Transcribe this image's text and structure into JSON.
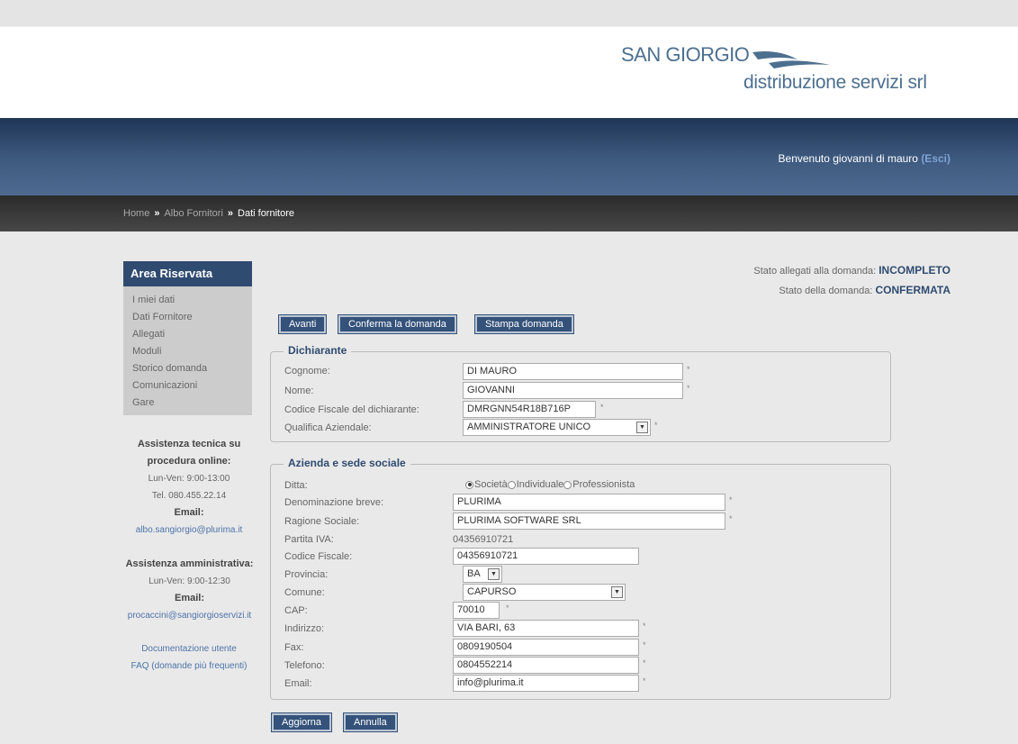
{
  "brand": {
    "line1": "SAN GIORGIO",
    "line2": "distribuzione servizi srl"
  },
  "header": {
    "welcome": "Benvenuto giovanni di mauro",
    "logout": "(Esci)"
  },
  "breadcrumb": {
    "home": "Home",
    "sep": "»",
    "albo": "Albo Fornitori",
    "current": "Dati fornitore"
  },
  "sidebar": {
    "title": "Area Riservata",
    "items": [
      "I miei dati",
      "Dati Fornitore",
      "Allegati",
      "Moduli",
      "Storico domanda",
      "Comunicazioni",
      "Gare"
    ]
  },
  "assist_tech": {
    "title1": "Assistenza tecnica su",
    "title2": "procedura online:",
    "hours": "Lun-Ven: 9:00-13:00",
    "tel": "Tel. 080.455.22.14",
    "email_label": "Email:",
    "email": "albo.sangiorgio@plurima.it"
  },
  "assist_admin": {
    "title": "Assistenza amministrativa:",
    "hours": "Lun-Ven: 9:00-12:30",
    "email_label": "Email:",
    "email": "procaccini@sangiorgioservizi.it"
  },
  "links": {
    "docs": "Documentazione utente",
    "faq": "FAQ (domande più frequenti)"
  },
  "status": {
    "attachments_label": "Stato allegati alla domanda:",
    "attachments_value": "INCOMPLETO",
    "application_label": "Stato della domanda:",
    "application_value": "CONFERMATA"
  },
  "actions": {
    "next": "Avanti",
    "confirm": "Conferma la domanda",
    "print": "Stampa domanda",
    "update": "Aggiorna",
    "cancel": "Annulla"
  },
  "required_mark": "*",
  "dichiarante": {
    "legend": "Dichiarante",
    "cognome_label": "Cognome:",
    "cognome": "DI MAURO",
    "nome_label": "Nome:",
    "nome": "GIOVANNI",
    "cf_label": "Codice Fiscale del dichiarante:",
    "cf": "DMRGNN54R18B716P",
    "qualifica_label": "Qualifica Aziendale:",
    "qualifica": "AMMINISTRATORE UNICO"
  },
  "azienda": {
    "legend": "Azienda e sede sociale",
    "ditta_label": "Ditta:",
    "ditta_options": [
      "Società",
      "Individuale",
      "Professionista"
    ],
    "denominazione_label": "Denominazione breve:",
    "denominazione": "PLURIMA",
    "ragione_label": "Ragione Sociale:",
    "ragione": "PLURIMA SOFTWARE SRL",
    "piva_label": "Partita IVA:",
    "piva": "04356910721",
    "cf_label": "Codice Fiscale:",
    "cf": "04356910721",
    "provincia_label": "Provincia:",
    "provincia": "BA",
    "comune_label": "Comune:",
    "comune": "CAPURSO",
    "cap_label": "CAP:",
    "cap": "70010",
    "indirizzo_label": "Indirizzo:",
    "indirizzo": "VIA BARI, 63",
    "fax_label": "Fax:",
    "fax": "0809190504",
    "telefono_label": "Telefono:",
    "telefono": "0804552214",
    "email_label": "Email:",
    "email": "info@plurima.it"
  }
}
